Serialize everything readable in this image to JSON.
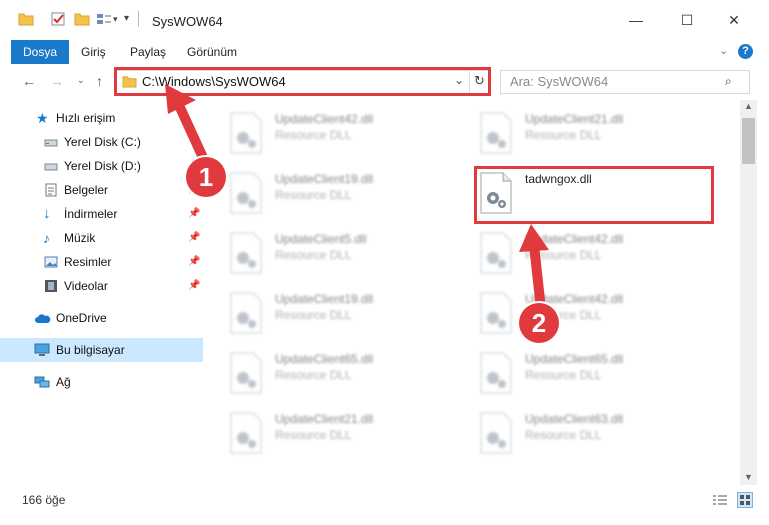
{
  "window": {
    "title": "SysWOW64",
    "minimize_label": "—",
    "maximize_label": "☐",
    "close_label": "✕"
  },
  "ribbon": {
    "tabs": [
      {
        "label": "Dosya",
        "active": true
      },
      {
        "label": "Giriş",
        "active": false
      },
      {
        "label": "Paylaş",
        "active": false
      },
      {
        "label": "Görünüm",
        "active": false
      }
    ],
    "help_label": "?"
  },
  "navigation": {
    "address": "C:\\Windows\\SysWOW64",
    "search_placeholder": "Ara: SysWOW64"
  },
  "sidebar": {
    "items": [
      {
        "label": "Hızlı erişim",
        "icon": "star-icon"
      },
      {
        "label": "Yerel Disk (C:)",
        "icon": "drive-icon"
      },
      {
        "label": "Yerel Disk (D:)",
        "icon": "drive-icon"
      },
      {
        "label": "Belgeler",
        "icon": "documents-icon"
      },
      {
        "label": "İndirmeler",
        "icon": "download-icon"
      },
      {
        "label": "Müzik",
        "icon": "music-icon"
      },
      {
        "label": "Resimler",
        "icon": "pictures-icon"
      },
      {
        "label": "Videolar",
        "icon": "videos-icon"
      },
      {
        "label": "OneDrive",
        "icon": "cloud-icon"
      },
      {
        "label": "Bu bilgisayar",
        "icon": "computer-icon"
      },
      {
        "label": "Ağ",
        "icon": "network-icon"
      }
    ]
  },
  "files": {
    "description": "Resource DLL",
    "items": [
      {
        "name": "UpdateClient42.dll"
      },
      {
        "name": "UpdateClient21.dll"
      },
      {
        "name": "UpdateClient19.dll"
      },
      {
        "name": "tadwngox.dll"
      },
      {
        "name": "UpdateClient5.dll"
      },
      {
        "name": "UpdateClient42.dll"
      },
      {
        "name": "UpdateClient19.dll"
      },
      {
        "name": "UpdateClient42.dll"
      },
      {
        "name": "UpdateClient65.dll"
      },
      {
        "name": "UpdateClient65.dll"
      },
      {
        "name": "UpdateClient21.dll"
      },
      {
        "name": "UpdateClient63.dll"
      }
    ]
  },
  "status": {
    "count_text": "166 öğe"
  },
  "annotations": {
    "badge1": "1",
    "badge2": "2"
  },
  "colors": {
    "accent": "#1979ca",
    "highlight": "#e0393e",
    "selected": "#cce8ff"
  }
}
